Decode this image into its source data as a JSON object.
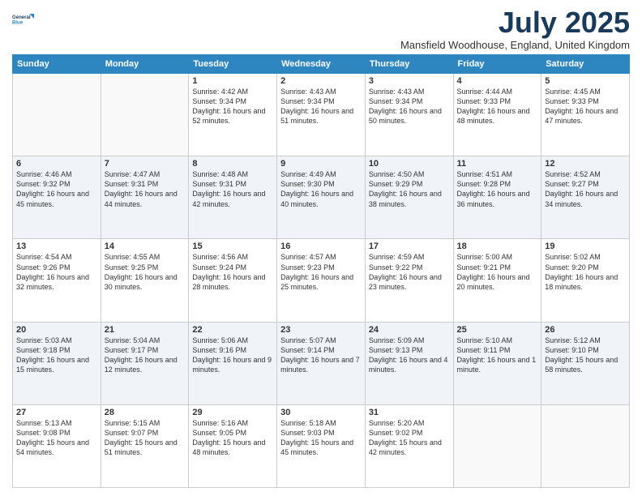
{
  "logo": {
    "line1": "General",
    "line2": "Blue"
  },
  "title": "July 2025",
  "subtitle": "Mansfield Woodhouse, England, United Kingdom",
  "days_of_week": [
    "Sunday",
    "Monday",
    "Tuesday",
    "Wednesday",
    "Thursday",
    "Friday",
    "Saturday"
  ],
  "weeks": [
    [
      {
        "day": "",
        "info": ""
      },
      {
        "day": "",
        "info": ""
      },
      {
        "day": "1",
        "info": "Sunrise: 4:42 AM\nSunset: 9:34 PM\nDaylight: 16 hours and 52 minutes."
      },
      {
        "day": "2",
        "info": "Sunrise: 4:43 AM\nSunset: 9:34 PM\nDaylight: 16 hours and 51 minutes."
      },
      {
        "day": "3",
        "info": "Sunrise: 4:43 AM\nSunset: 9:34 PM\nDaylight: 16 hours and 50 minutes."
      },
      {
        "day": "4",
        "info": "Sunrise: 4:44 AM\nSunset: 9:33 PM\nDaylight: 16 hours and 48 minutes."
      },
      {
        "day": "5",
        "info": "Sunrise: 4:45 AM\nSunset: 9:33 PM\nDaylight: 16 hours and 47 minutes."
      }
    ],
    [
      {
        "day": "6",
        "info": "Sunrise: 4:46 AM\nSunset: 9:32 PM\nDaylight: 16 hours and 45 minutes."
      },
      {
        "day": "7",
        "info": "Sunrise: 4:47 AM\nSunset: 9:31 PM\nDaylight: 16 hours and 44 minutes."
      },
      {
        "day": "8",
        "info": "Sunrise: 4:48 AM\nSunset: 9:31 PM\nDaylight: 16 hours and 42 minutes."
      },
      {
        "day": "9",
        "info": "Sunrise: 4:49 AM\nSunset: 9:30 PM\nDaylight: 16 hours and 40 minutes."
      },
      {
        "day": "10",
        "info": "Sunrise: 4:50 AM\nSunset: 9:29 PM\nDaylight: 16 hours and 38 minutes."
      },
      {
        "day": "11",
        "info": "Sunrise: 4:51 AM\nSunset: 9:28 PM\nDaylight: 16 hours and 36 minutes."
      },
      {
        "day": "12",
        "info": "Sunrise: 4:52 AM\nSunset: 9:27 PM\nDaylight: 16 hours and 34 minutes."
      }
    ],
    [
      {
        "day": "13",
        "info": "Sunrise: 4:54 AM\nSunset: 9:26 PM\nDaylight: 16 hours and 32 minutes."
      },
      {
        "day": "14",
        "info": "Sunrise: 4:55 AM\nSunset: 9:25 PM\nDaylight: 16 hours and 30 minutes."
      },
      {
        "day": "15",
        "info": "Sunrise: 4:56 AM\nSunset: 9:24 PM\nDaylight: 16 hours and 28 minutes."
      },
      {
        "day": "16",
        "info": "Sunrise: 4:57 AM\nSunset: 9:23 PM\nDaylight: 16 hours and 25 minutes."
      },
      {
        "day": "17",
        "info": "Sunrise: 4:59 AM\nSunset: 9:22 PM\nDaylight: 16 hours and 23 minutes."
      },
      {
        "day": "18",
        "info": "Sunrise: 5:00 AM\nSunset: 9:21 PM\nDaylight: 16 hours and 20 minutes."
      },
      {
        "day": "19",
        "info": "Sunrise: 5:02 AM\nSunset: 9:20 PM\nDaylight: 16 hours and 18 minutes."
      }
    ],
    [
      {
        "day": "20",
        "info": "Sunrise: 5:03 AM\nSunset: 9:18 PM\nDaylight: 16 hours and 15 minutes."
      },
      {
        "day": "21",
        "info": "Sunrise: 5:04 AM\nSunset: 9:17 PM\nDaylight: 16 hours and 12 minutes."
      },
      {
        "day": "22",
        "info": "Sunrise: 5:06 AM\nSunset: 9:16 PM\nDaylight: 16 hours and 9 minutes."
      },
      {
        "day": "23",
        "info": "Sunrise: 5:07 AM\nSunset: 9:14 PM\nDaylight: 16 hours and 7 minutes."
      },
      {
        "day": "24",
        "info": "Sunrise: 5:09 AM\nSunset: 9:13 PM\nDaylight: 16 hours and 4 minutes."
      },
      {
        "day": "25",
        "info": "Sunrise: 5:10 AM\nSunset: 9:11 PM\nDaylight: 16 hours and 1 minute."
      },
      {
        "day": "26",
        "info": "Sunrise: 5:12 AM\nSunset: 9:10 PM\nDaylight: 15 hours and 58 minutes."
      }
    ],
    [
      {
        "day": "27",
        "info": "Sunrise: 5:13 AM\nSunset: 9:08 PM\nDaylight: 15 hours and 54 minutes."
      },
      {
        "day": "28",
        "info": "Sunrise: 5:15 AM\nSunset: 9:07 PM\nDaylight: 15 hours and 51 minutes."
      },
      {
        "day": "29",
        "info": "Sunrise: 5:16 AM\nSunset: 9:05 PM\nDaylight: 15 hours and 48 minutes."
      },
      {
        "day": "30",
        "info": "Sunrise: 5:18 AM\nSunset: 9:03 PM\nDaylight: 15 hours and 45 minutes."
      },
      {
        "day": "31",
        "info": "Sunrise: 5:20 AM\nSunset: 9:02 PM\nDaylight: 15 hours and 42 minutes."
      },
      {
        "day": "",
        "info": ""
      },
      {
        "day": "",
        "info": ""
      }
    ]
  ]
}
